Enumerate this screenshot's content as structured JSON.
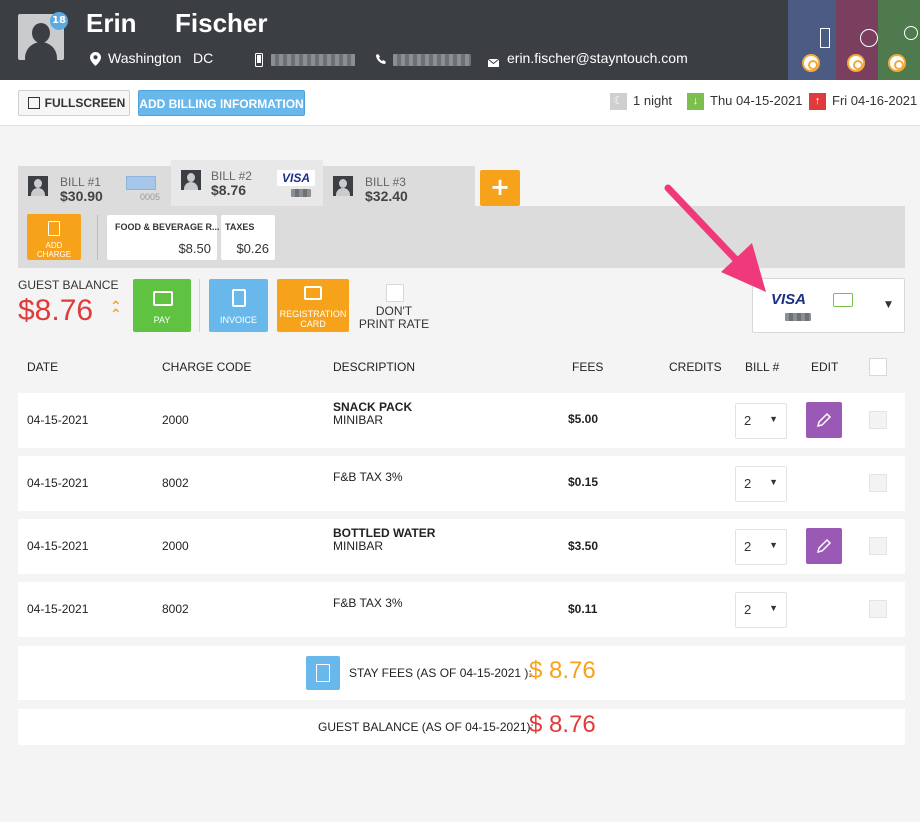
{
  "guest": {
    "first_name": "Erin",
    "last_name": "Fischer",
    "badge_count": "18",
    "city": "Washington",
    "state": "DC",
    "email": "erin.fischer@stayntouch.com"
  },
  "toolbar": {
    "fullscreen_label": "FULLSCREEN",
    "add_billing_label": "ADD BILLING INFORMATION",
    "nights": "1 night",
    "arrival": "Thu 04-15-2021",
    "departure": "Fri 04-16-2021"
  },
  "bills": [
    {
      "label": "BILL #1",
      "amount": "$30.90",
      "card_last4": "0005"
    },
    {
      "label": "BILL #2",
      "amount": "$8.76",
      "card_brand": "VISA"
    },
    {
      "label": "BILL #3",
      "amount": "$32.40"
    }
  ],
  "add_bill_label": "+",
  "charges": {
    "add_charge_label_1": "ADD",
    "add_charge_label_2": "CHARGE",
    "cards": [
      {
        "title": "FOOD & BEVERAGE R...",
        "value": "$8.50"
      },
      {
        "title": "TAXES",
        "value": "$0.26"
      }
    ]
  },
  "balance": {
    "label": "GUEST BALANCE",
    "amount": "$8.76",
    "pay_label": "PAY",
    "invoice_label": "INVOICE",
    "registration_label_1": "REGISTRATION",
    "registration_label_2": "CARD",
    "dont_print_label": "DON'T PRINT RATE",
    "card_brand": "VISA"
  },
  "table": {
    "headers": {
      "date": "DATE",
      "charge_code": "CHARGE CODE",
      "description": "DESCRIPTION",
      "fees": "FEES",
      "credits": "CREDITS",
      "bill": "BILL #",
      "edit": "EDIT"
    },
    "rows": [
      {
        "date": "04-15-2021",
        "code": "2000",
        "desc1": "SNACK PACK",
        "desc2": "MINIBAR",
        "fee": "$5.00",
        "bill": "2"
      },
      {
        "date": "04-15-2021",
        "code": "8002",
        "desc1": "",
        "desc2": "F&B TAX 3%",
        "fee": "$0.15",
        "bill": "2"
      },
      {
        "date": "04-15-2021",
        "code": "2000",
        "desc1": "BOTTLED WATER",
        "desc2": "MINIBAR",
        "fee": "$3.50",
        "bill": "2"
      },
      {
        "date": "04-15-2021",
        "code": "8002",
        "desc1": "",
        "desc2": "F&B TAX 3%",
        "fee": "$0.11",
        "bill": "2"
      }
    ]
  },
  "totals": {
    "stay_fees_label": "STAY FEES (AS OF 04-15-2021 ):",
    "stay_fees_amount": "$ 8.76",
    "guest_balance_label": "GUEST BALANCE (AS OF 04-15-2021):",
    "guest_balance_amount": "$ 8.76"
  },
  "colors": {
    "header_bg": "#3b3f44",
    "accent_orange": "#f7a21b",
    "pay_green": "#5fc341",
    "invoice_blue": "#69b8ec",
    "edit_purple": "#9b59b6",
    "balance_red": "#e03a3a",
    "annotation_pink": "#f0397a"
  }
}
